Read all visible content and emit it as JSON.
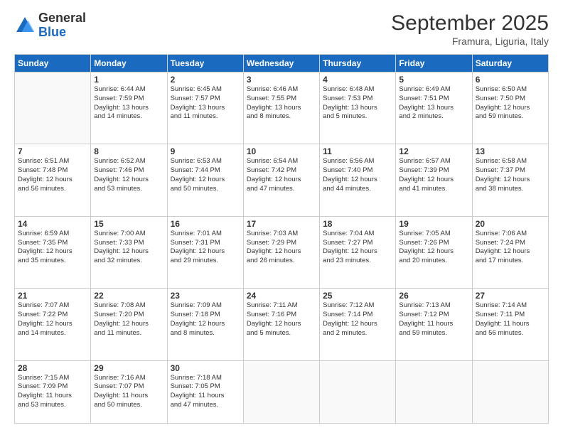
{
  "logo": {
    "general": "General",
    "blue": "Blue"
  },
  "header": {
    "month": "September 2025",
    "location": "Framura, Liguria, Italy"
  },
  "weekdays": [
    "Sunday",
    "Monday",
    "Tuesday",
    "Wednesday",
    "Thursday",
    "Friday",
    "Saturday"
  ],
  "weeks": [
    [
      {
        "day": "",
        "info": ""
      },
      {
        "day": "1",
        "info": "Sunrise: 6:44 AM\nSunset: 7:59 PM\nDaylight: 13 hours\nand 14 minutes."
      },
      {
        "day": "2",
        "info": "Sunrise: 6:45 AM\nSunset: 7:57 PM\nDaylight: 13 hours\nand 11 minutes."
      },
      {
        "day": "3",
        "info": "Sunrise: 6:46 AM\nSunset: 7:55 PM\nDaylight: 13 hours\nand 8 minutes."
      },
      {
        "day": "4",
        "info": "Sunrise: 6:48 AM\nSunset: 7:53 PM\nDaylight: 13 hours\nand 5 minutes."
      },
      {
        "day": "5",
        "info": "Sunrise: 6:49 AM\nSunset: 7:51 PM\nDaylight: 13 hours\nand 2 minutes."
      },
      {
        "day": "6",
        "info": "Sunrise: 6:50 AM\nSunset: 7:50 PM\nDaylight: 12 hours\nand 59 minutes."
      }
    ],
    [
      {
        "day": "7",
        "info": "Sunrise: 6:51 AM\nSunset: 7:48 PM\nDaylight: 12 hours\nand 56 minutes."
      },
      {
        "day": "8",
        "info": "Sunrise: 6:52 AM\nSunset: 7:46 PM\nDaylight: 12 hours\nand 53 minutes."
      },
      {
        "day": "9",
        "info": "Sunrise: 6:53 AM\nSunset: 7:44 PM\nDaylight: 12 hours\nand 50 minutes."
      },
      {
        "day": "10",
        "info": "Sunrise: 6:54 AM\nSunset: 7:42 PM\nDaylight: 12 hours\nand 47 minutes."
      },
      {
        "day": "11",
        "info": "Sunrise: 6:56 AM\nSunset: 7:40 PM\nDaylight: 12 hours\nand 44 minutes."
      },
      {
        "day": "12",
        "info": "Sunrise: 6:57 AM\nSunset: 7:39 PM\nDaylight: 12 hours\nand 41 minutes."
      },
      {
        "day": "13",
        "info": "Sunrise: 6:58 AM\nSunset: 7:37 PM\nDaylight: 12 hours\nand 38 minutes."
      }
    ],
    [
      {
        "day": "14",
        "info": "Sunrise: 6:59 AM\nSunset: 7:35 PM\nDaylight: 12 hours\nand 35 minutes."
      },
      {
        "day": "15",
        "info": "Sunrise: 7:00 AM\nSunset: 7:33 PM\nDaylight: 12 hours\nand 32 minutes."
      },
      {
        "day": "16",
        "info": "Sunrise: 7:01 AM\nSunset: 7:31 PM\nDaylight: 12 hours\nand 29 minutes."
      },
      {
        "day": "17",
        "info": "Sunrise: 7:03 AM\nSunset: 7:29 PM\nDaylight: 12 hours\nand 26 minutes."
      },
      {
        "day": "18",
        "info": "Sunrise: 7:04 AM\nSunset: 7:27 PM\nDaylight: 12 hours\nand 23 minutes."
      },
      {
        "day": "19",
        "info": "Sunrise: 7:05 AM\nSunset: 7:26 PM\nDaylight: 12 hours\nand 20 minutes."
      },
      {
        "day": "20",
        "info": "Sunrise: 7:06 AM\nSunset: 7:24 PM\nDaylight: 12 hours\nand 17 minutes."
      }
    ],
    [
      {
        "day": "21",
        "info": "Sunrise: 7:07 AM\nSunset: 7:22 PM\nDaylight: 12 hours\nand 14 minutes."
      },
      {
        "day": "22",
        "info": "Sunrise: 7:08 AM\nSunset: 7:20 PM\nDaylight: 12 hours\nand 11 minutes."
      },
      {
        "day": "23",
        "info": "Sunrise: 7:09 AM\nSunset: 7:18 PM\nDaylight: 12 hours\nand 8 minutes."
      },
      {
        "day": "24",
        "info": "Sunrise: 7:11 AM\nSunset: 7:16 PM\nDaylight: 12 hours\nand 5 minutes."
      },
      {
        "day": "25",
        "info": "Sunrise: 7:12 AM\nSunset: 7:14 PM\nDaylight: 12 hours\nand 2 minutes."
      },
      {
        "day": "26",
        "info": "Sunrise: 7:13 AM\nSunset: 7:12 PM\nDaylight: 11 hours\nand 59 minutes."
      },
      {
        "day": "27",
        "info": "Sunrise: 7:14 AM\nSunset: 7:11 PM\nDaylight: 11 hours\nand 56 minutes."
      }
    ],
    [
      {
        "day": "28",
        "info": "Sunrise: 7:15 AM\nSunset: 7:09 PM\nDaylight: 11 hours\nand 53 minutes."
      },
      {
        "day": "29",
        "info": "Sunrise: 7:16 AM\nSunset: 7:07 PM\nDaylight: 11 hours\nand 50 minutes."
      },
      {
        "day": "30",
        "info": "Sunrise: 7:18 AM\nSunset: 7:05 PM\nDaylight: 11 hours\nand 47 minutes."
      },
      {
        "day": "",
        "info": ""
      },
      {
        "day": "",
        "info": ""
      },
      {
        "day": "",
        "info": ""
      },
      {
        "day": "",
        "info": ""
      }
    ]
  ]
}
